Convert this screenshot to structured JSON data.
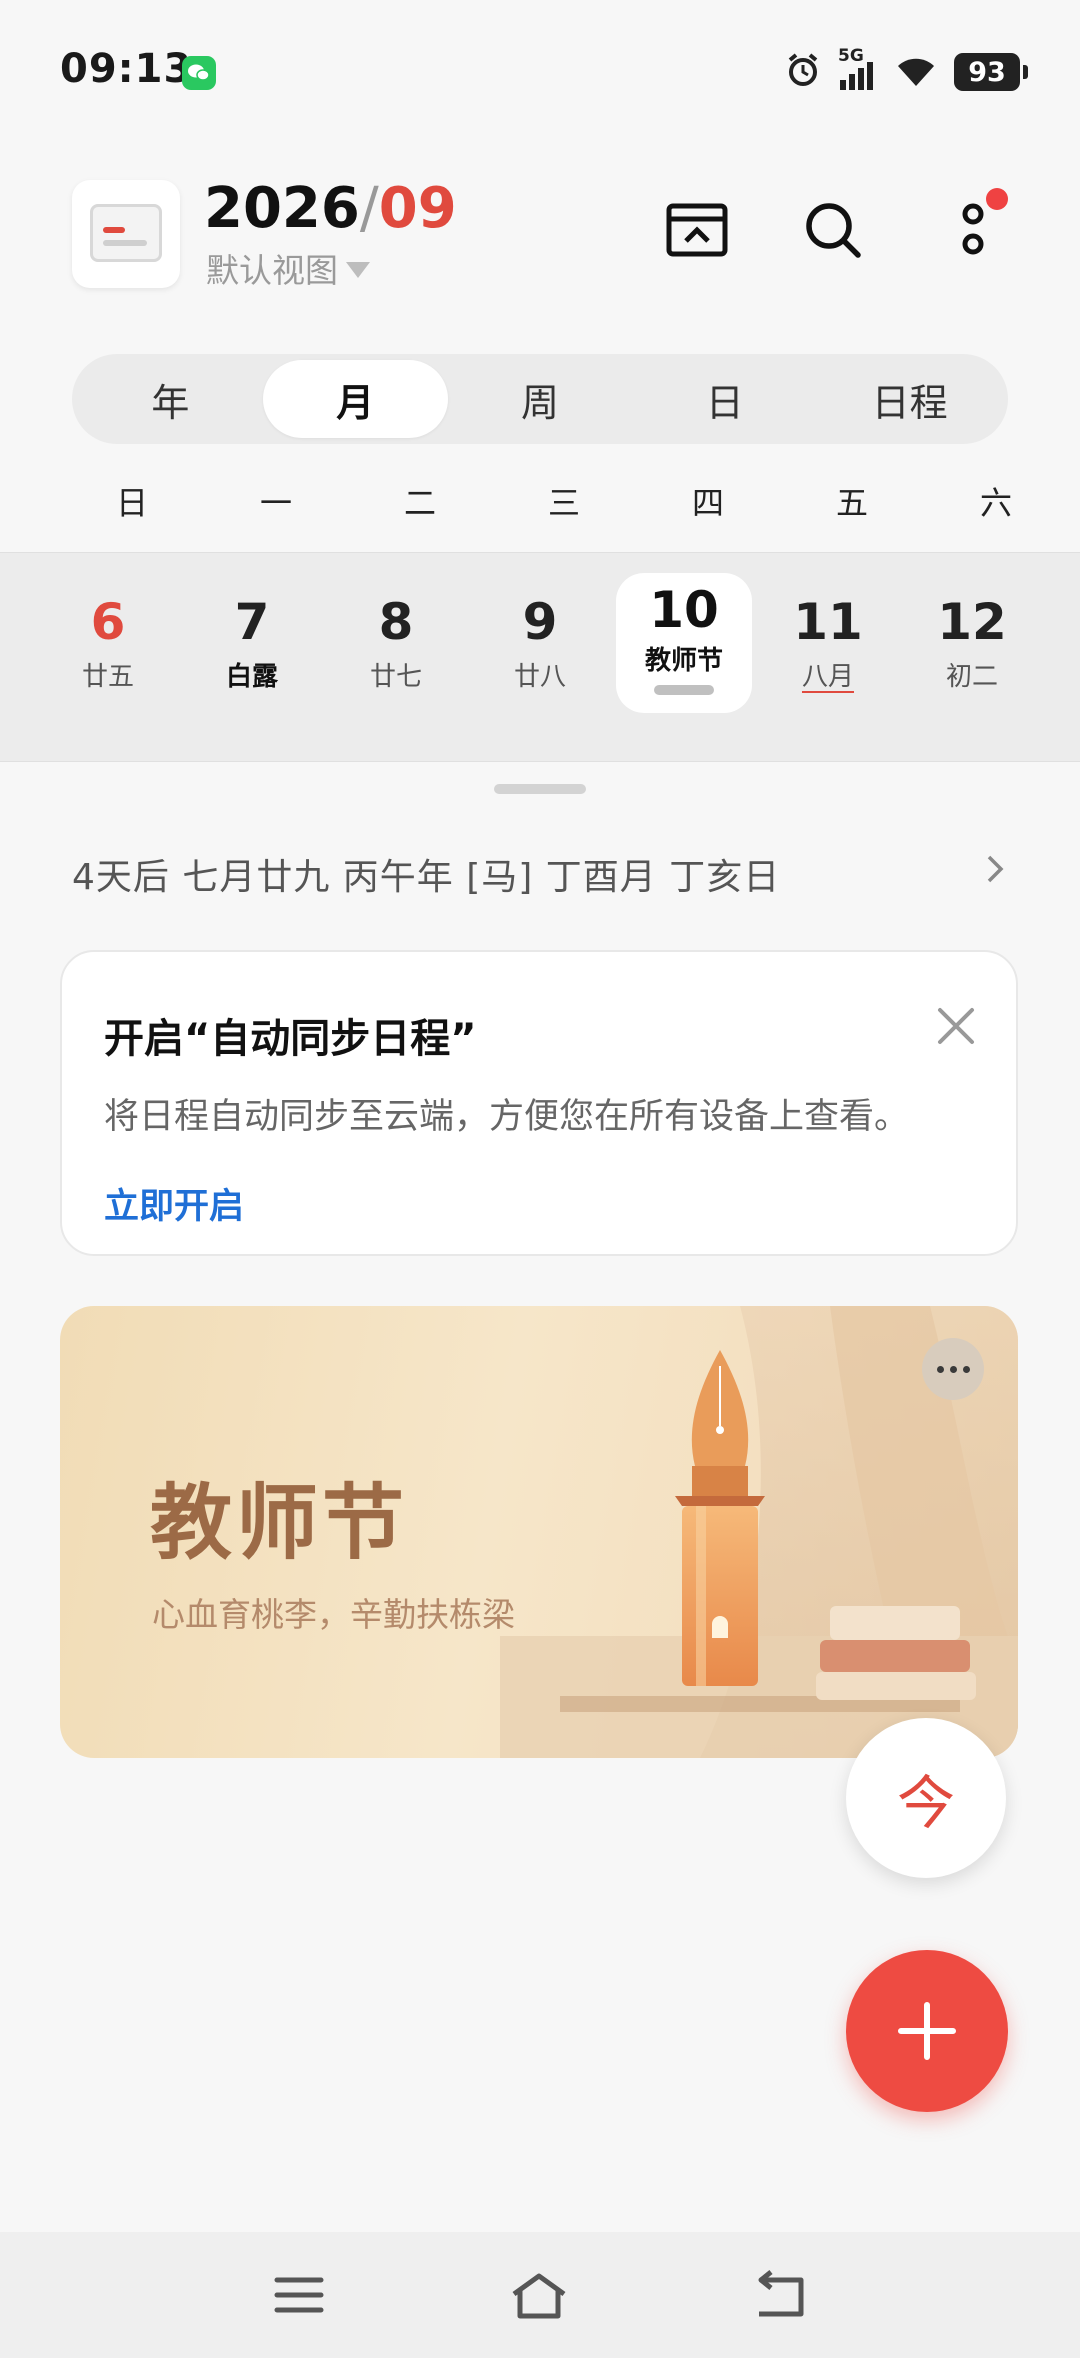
{
  "status_bar": {
    "time": "09:13",
    "network": "5G",
    "battery": "93",
    "icons": [
      "wechat-icon",
      "alarm-icon",
      "signal-icon",
      "wifi-icon",
      "battery-icon"
    ]
  },
  "header": {
    "year": "2026",
    "separator": "/",
    "month": "09",
    "view_name": "默认视图",
    "icons": [
      "app-logo-icon",
      "inbox-icon",
      "search-icon",
      "more-icon"
    ],
    "notification_dot_color": "#ef4242"
  },
  "view_tabs": [
    {
      "label": "年",
      "active": false
    },
    {
      "label": "月",
      "active": true
    },
    {
      "label": "周",
      "active": false
    },
    {
      "label": "日",
      "active": false
    },
    {
      "label": "日程",
      "active": false
    }
  ],
  "weekdays": [
    "日",
    "一",
    "二",
    "三",
    "四",
    "五",
    "六"
  ],
  "week": [
    {
      "day": "6",
      "lunar": "廿五"
    },
    {
      "day": "7",
      "lunar": "白露"
    },
    {
      "day": "8",
      "lunar": "廿七"
    },
    {
      "day": "9",
      "lunar": "廿八"
    },
    {
      "day": "10",
      "lunar": "教师节"
    },
    {
      "day": "11",
      "lunar": "八月"
    },
    {
      "day": "12",
      "lunar": "初二"
    }
  ],
  "lunar_info": "4天后 七月廿九 丙午年 [马] 丁酉月 丁亥日",
  "sync_card": {
    "title": "开启“自动同步日程”",
    "description": "将日程自动同步至云端，方便您在所有设备上查看。",
    "action": "立即开启"
  },
  "banner": {
    "title": "教师节",
    "subtitle": "心血育桃李，辛勤扶栋梁"
  },
  "today_button": "今",
  "colors": {
    "accent": "#e04a3e",
    "fab": "#ee4b42",
    "link": "#1f6fd6"
  }
}
